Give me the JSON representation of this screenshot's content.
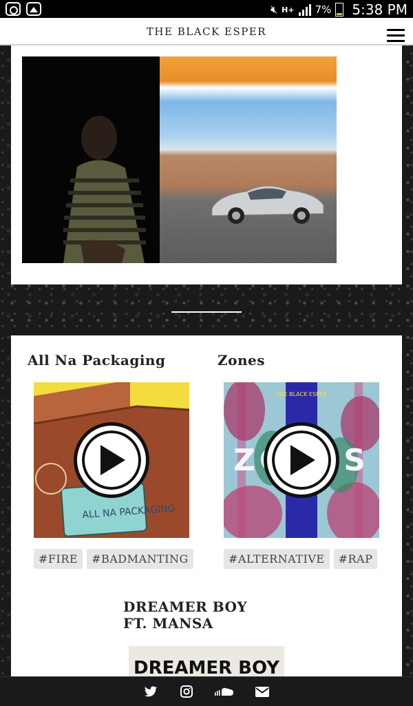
{
  "status_bar": {
    "battery": "7%",
    "time": "5:38 PM",
    "network": "H+",
    "icons": [
      "instagram-icon",
      "gallery-icon",
      "mute-icon",
      "signal-icon",
      "battery-icon"
    ]
  },
  "header": {
    "title": "THE BLACK ESPER",
    "menu_icon": "hamburger-menu-icon"
  },
  "tracks": [
    {
      "title": "All Na Packaging",
      "tags": [
        "#FIRE",
        "#BADMANTING"
      ],
      "cover_text": "ALL NA PACKAGING"
    },
    {
      "title": "Zones",
      "tags": [
        "#ALTERNATIVE",
        "#RAP"
      ],
      "cover_text_top": "THE BLACK ESPER",
      "cover_text": "ZONES"
    },
    {
      "title": "DREAMER BOY FT. MANSA",
      "cover_text": "DREAMER BOY"
    }
  ],
  "footer": {
    "icons": [
      "twitter-icon",
      "instagram-icon",
      "soundcloud-icon",
      "email-icon"
    ]
  },
  "colors": {
    "accent": "#000000",
    "background": "#1a1a1a",
    "card": "#ffffff"
  }
}
